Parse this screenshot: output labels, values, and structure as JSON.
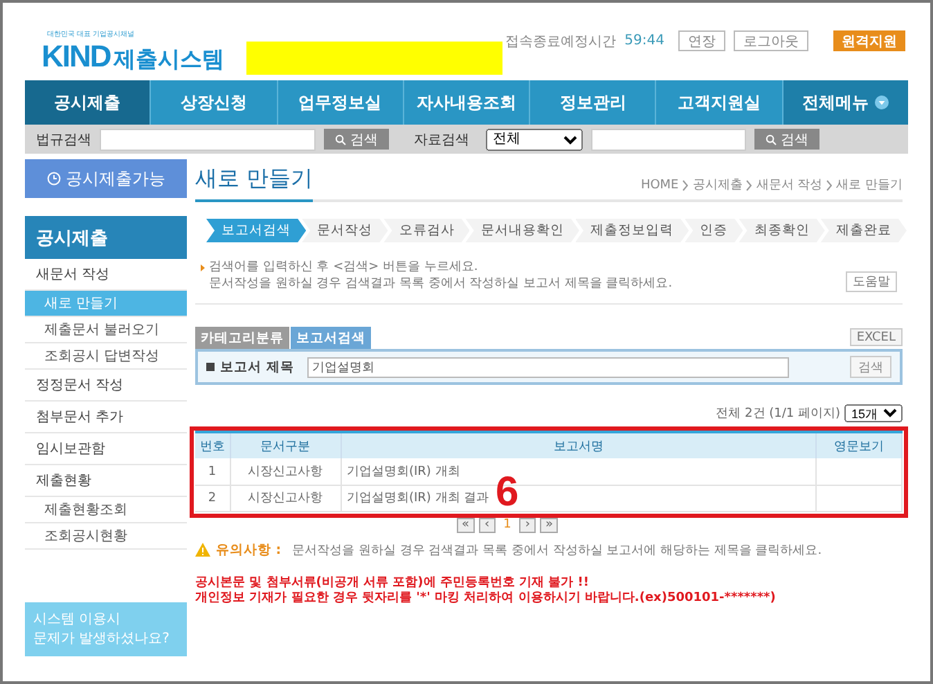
{
  "header": {
    "logo_tagline": "대한민국 대표 기업공시채널",
    "logo_mark": "KIND",
    "logo_text": "제출시스템",
    "session_label": "접속종료예정시간",
    "session_time": "59:44",
    "buttons": [
      "연장",
      "로그아웃"
    ],
    "remote_button": "원격지원"
  },
  "nav": [
    {
      "label": "공시제출",
      "selected": true
    },
    {
      "label": "상장신청",
      "selected": false
    },
    {
      "label": "업무정보실",
      "selected": false
    },
    {
      "label": "자사내용조회",
      "selected": false
    },
    {
      "label": "정보관리",
      "selected": false
    },
    {
      "label": "고객지원실",
      "selected": false
    },
    {
      "label": "전체메뉴",
      "selected": false
    }
  ],
  "search_bar": {
    "law_label": "법규검색",
    "law_button": "검색",
    "data_label": "자료검색",
    "data_select": "전체",
    "data_button": "검색"
  },
  "sidebar": {
    "status_button": "공시제출가능",
    "section_title": "공시제출",
    "items": [
      {
        "label": "새문서 작성",
        "selected": false,
        "children": [
          {
            "label": "새로 만들기",
            "selected": true
          },
          {
            "label": "제출문서 불러오기",
            "selected": false
          },
          {
            "label": "조회공시 답변작성",
            "selected": false
          }
        ]
      },
      {
        "label": "정정문서 작성",
        "selected": false
      },
      {
        "label": "첨부문서 추가",
        "selected": false
      },
      {
        "label": "임시보관함",
        "selected": false
      },
      {
        "label": "제출현황",
        "selected": false,
        "children": [
          {
            "label": "제출현황조회",
            "selected": false
          },
          {
            "label": "조회공시현황",
            "selected": false
          }
        ]
      }
    ],
    "help_banner": [
      "시스템 이용시",
      "문제가 발생하셨나요?"
    ]
  },
  "page": {
    "title": "새로 만들기",
    "breadcrumb": [
      "HOME",
      "공시제출",
      "새문서 작성",
      "새로 만들기"
    ],
    "steps": [
      {
        "label": "보고서검색",
        "selected": true
      },
      {
        "label": "문서작성",
        "selected": false
      },
      {
        "label": "오류검사",
        "selected": false
      },
      {
        "label": "문서내용확인",
        "selected": false
      },
      {
        "label": "제출정보입력",
        "selected": false
      },
      {
        "label": "인증",
        "selected": false
      },
      {
        "label": "최종확인",
        "selected": false
      },
      {
        "label": "제출완료",
        "selected": false
      }
    ],
    "instructions": [
      "검색어를 입력하신 후 <검색> 버튼을 누르세요.",
      "문서작성을 원하실 경우 검색결과 목록 중에서 작성하실 보고서 제목을 클릭하세요."
    ],
    "help_button": "도움말",
    "tabs": [
      {
        "label": "카테고리분류",
        "selected": false
      },
      {
        "label": "보고서검색",
        "selected": true
      }
    ],
    "excel_button": "EXCEL",
    "search": {
      "label": "보고서 제목",
      "value": "기업설명회",
      "button": "검색"
    },
    "result_count": "전체 2건 (1/1 페이지)",
    "page_size": "15개",
    "table": {
      "columns": [
        "번호",
        "문서구분",
        "보고서명",
        "영문보기"
      ],
      "rows": [
        [
          "1",
          "시장신고사항",
          "기업설명회(IR) 개최",
          ""
        ],
        [
          "2",
          "시장신고사항",
          "기업설명회(IR) 개최 결과",
          ""
        ]
      ]
    },
    "annotation": "6",
    "pagination": [
      {
        "label": "«",
        "selected": false
      },
      {
        "label": "‹",
        "selected": false
      },
      {
        "label": "1",
        "selected": true
      },
      {
        "label": "›",
        "selected": false
      },
      {
        "label": "»",
        "selected": false
      }
    ],
    "notice_label": "유의사항 :",
    "notice_text": "문서작성을 원하실 경우 검색결과 목록 중에서 작성하실 보고서에 해당하는 제목을 클릭하세요.",
    "warning": [
      "공시본문 및 첨부서류(비공개 서류 포함)에 주민등록번호 기재 불가 !!",
      "개인정보 기재가 필요한 경우 뒷자리를 '*' 마킹 처리하여 이용하시기 바랍니다.(ex)500101-*******)"
    ]
  }
}
